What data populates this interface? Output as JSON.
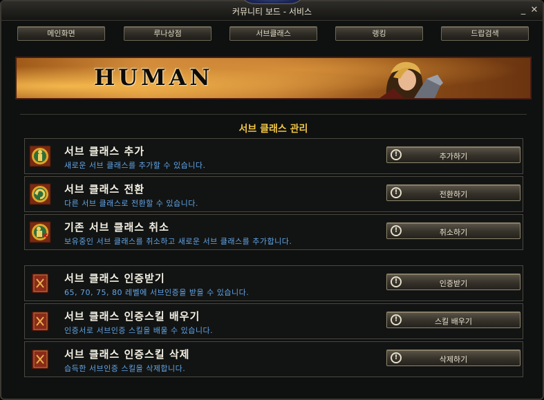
{
  "window": {
    "title": "커뮤니티 보드 - 서비스",
    "minimize": "_",
    "close": "✕"
  },
  "tabs": [
    "메인화면",
    "루나상점",
    "서브클래스",
    "랭킹",
    "드랍검색"
  ],
  "banner": {
    "title": "HUMAN"
  },
  "section": {
    "title": "서브 클래스 관리"
  },
  "rows": [
    {
      "title": "서브 클래스 추가",
      "desc": "새로운 서브 클래스를 추가할 수 있습니다.",
      "button": "추가하기",
      "icon": "add-subclass-icon"
    },
    {
      "title": "서브 클래스 전환",
      "desc": "다른 서브 클래스로 전환할 수 있습니다.",
      "button": "전환하기",
      "icon": "switch-subclass-icon"
    },
    {
      "title": "기존 서브 클래스 취소",
      "desc": "보유중인 서브 클래스를 취소하고 새로운 서브 클래스를 추가합니다.",
      "button": "취소하기",
      "icon": "cancel-subclass-icon"
    },
    {
      "title": "서브 클래스 인증받기",
      "desc": "65, 70, 75, 80 레벨에 서브인증을 받을 수 있습니다.",
      "button": "인증받기",
      "icon": "certificate-book-icon"
    },
    {
      "title": "서브 클래스 인증스킬 배우기",
      "desc": "인증서로 서브인증 스킬을 배울 수 있습니다.",
      "button": "스킬 배우기",
      "icon": "learn-skill-book-icon"
    },
    {
      "title": "서브 클래스 인증스킬 삭제",
      "desc": "습득한 서브인증 스킬을 삭제합니다.",
      "button": "삭제하기",
      "icon": "delete-skill-book-icon"
    }
  ],
  "colors": {
    "accent": "#f1c646",
    "desc": "#62a6ea"
  }
}
